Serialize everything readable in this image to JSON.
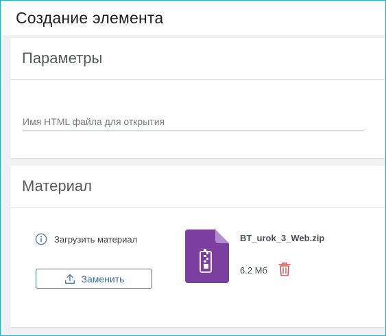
{
  "header": {
    "title": "Создание элемента"
  },
  "params": {
    "title": "Параметры",
    "html_file_field": {
      "placeholder": "Имя HTML файла для открытия",
      "value": ""
    }
  },
  "material": {
    "title": "Материал",
    "upload_label": "Загрузить материал",
    "replace_label": "Заменить",
    "file": {
      "name": "BT_urok_3_Web.zip",
      "size": "6.2 Мб",
      "icon": "zip-file-icon",
      "color": "#7b3fa0"
    }
  },
  "icons": {
    "info": "info-circle-icon",
    "upload": "upload-icon",
    "delete": "trash-icon"
  },
  "colors": {
    "accent": "#3a6ea5",
    "danger": "#d9534f",
    "frame_border": "#1fb2c8"
  }
}
